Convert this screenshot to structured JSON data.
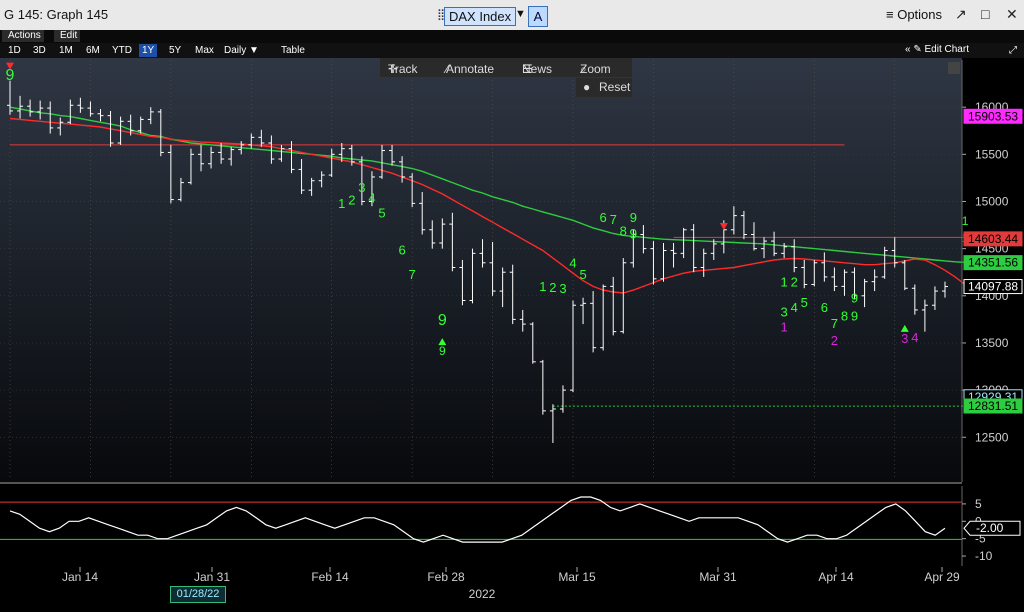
{
  "window": {
    "title": "G 145: Graph 145",
    "ticker": "DAX Index",
    "ticker_button": "A",
    "options": "Options"
  },
  "menu": {
    "actions": "Actions",
    "edit": "Edit"
  },
  "ranges": [
    "1D",
    "3D",
    "1M",
    "6M",
    "YTD",
    "1Y",
    "5Y",
    "Max"
  ],
  "active_range": "1Y",
  "period": "Daily",
  "table_label": "Table",
  "edit_chart": "Edit Chart",
  "floating": {
    "track": "Track",
    "annotate": "Annotate",
    "news": "News",
    "zoom": "Zoom",
    "reset": "Reset"
  },
  "colors": {
    "price": "#ffffff",
    "ma_fast": "#ff2a2a",
    "ma_slow": "#2ecc40",
    "td_count": "#33ff33",
    "td_count_alt": "#dd22dd",
    "osc": "#ffffff"
  },
  "chart_data": {
    "type": "bar",
    "ylim": [
      12100,
      16500
    ],
    "y_ticks": [
      12500,
      13000,
      13500,
      14000,
      14500,
      15000,
      15500,
      16000
    ],
    "x_ticks": [
      "Jan 14",
      "Jan 31",
      "Feb 14",
      "Feb 28",
      "Mar 15",
      "Mar 31",
      "Apr 14",
      "Apr 29"
    ],
    "x_year": "2022",
    "cursor_date": "01/28/22",
    "price_labels": [
      {
        "value": "15903.53",
        "color": "#ff2aff"
      },
      {
        "value": "14603.44",
        "color": "#e23b3b"
      },
      {
        "value": "14351.56",
        "color": "#2ecc40"
      },
      {
        "value": "14097.88",
        "color": "#ffffff"
      },
      {
        "value": "12929.31",
        "color": "#9fe6ff"
      },
      {
        "value": "12831.51",
        "color": "#2ecc40"
      }
    ],
    "ohlc": [
      [
        16020,
        16280,
        15920,
        15960
      ],
      [
        15960,
        16120,
        15880,
        16010
      ],
      [
        16010,
        16080,
        15900,
        15950
      ],
      [
        15950,
        16070,
        15870,
        15990
      ],
      [
        15990,
        16060,
        15720,
        15780
      ],
      [
        15780,
        15890,
        15700,
        15840
      ],
      [
        15840,
        16080,
        15820,
        16020
      ],
      [
        16020,
        16100,
        15940,
        15990
      ],
      [
        15990,
        16060,
        15900,
        15930
      ],
      [
        15930,
        15980,
        15850,
        15910
      ],
      [
        15910,
        15960,
        15580,
        15620
      ],
      [
        15620,
        15900,
        15600,
        15850
      ],
      [
        15850,
        15920,
        15700,
        15750
      ],
      [
        15750,
        15900,
        15720,
        15870
      ],
      [
        15870,
        16000,
        15820,
        15950
      ],
      [
        15950,
        15980,
        15480,
        15520
      ],
      [
        15520,
        15600,
        14980,
        15020
      ],
      [
        15020,
        15250,
        15000,
        15200
      ],
      [
        15200,
        15560,
        15180,
        15500
      ],
      [
        15500,
        15600,
        15320,
        15400
      ],
      [
        15400,
        15580,
        15350,
        15520
      ],
      [
        15520,
        15620,
        15400,
        15450
      ],
      [
        15450,
        15580,
        15380,
        15550
      ],
      [
        15550,
        15640,
        15500,
        15600
      ],
      [
        15600,
        15720,
        15560,
        15680
      ],
      [
        15680,
        15760,
        15580,
        15620
      ],
      [
        15620,
        15700,
        15400,
        15450
      ],
      [
        15450,
        15600,
        15420,
        15560
      ],
      [
        15560,
        15640,
        15300,
        15340
      ],
      [
        15340,
        15450,
        15080,
        15120
      ],
      [
        15120,
        15250,
        15060,
        15220
      ],
      [
        15220,
        15320,
        15150,
        15280
      ],
      [
        15280,
        15560,
        15260,
        15500
      ],
      [
        15500,
        15620,
        15420,
        15560
      ],
      [
        15560,
        15600,
        15380,
        15420
      ],
      [
        15420,
        15480,
        14960,
        15000
      ],
      [
        15000,
        15320,
        14950,
        15260
      ],
      [
        15260,
        15600,
        15240,
        15540
      ],
      [
        15540,
        15600,
        15380,
        15420
      ],
      [
        15420,
        15480,
        15200,
        15260
      ],
      [
        15260,
        15300,
        14940,
        14980
      ],
      [
        14980,
        15100,
        14650,
        14700
      ],
      [
        14700,
        14800,
        14500,
        14560
      ],
      [
        14560,
        14820,
        14500,
        14760
      ],
      [
        14760,
        14880,
        14260,
        14300
      ],
      [
        14300,
        14380,
        13900,
        13950
      ],
      [
        13950,
        14500,
        13920,
        14450
      ],
      [
        14450,
        14600,
        14300,
        14350
      ],
      [
        14350,
        14570,
        14000,
        14050
      ],
      [
        14050,
        14300,
        13880,
        14250
      ],
      [
        14250,
        14330,
        13700,
        13750
      ],
      [
        13750,
        13850,
        13620,
        13700
      ],
      [
        13700,
        13720,
        13280,
        13300
      ],
      [
        13300,
        13320,
        12740,
        12780
      ],
      [
        12780,
        12850,
        12440,
        12800
      ],
      [
        12800,
        13050,
        12760,
        13000
      ],
      [
        13000,
        13950,
        12980,
        13900
      ],
      [
        13900,
        13980,
        13700,
        13920
      ],
      [
        13920,
        14050,
        13400,
        13450
      ],
      [
        13450,
        14120,
        13420,
        14100
      ],
      [
        14100,
        14200,
        13580,
        13620
      ],
      [
        13620,
        14400,
        13600,
        14350
      ],
      [
        14350,
        14700,
        14300,
        14650
      ],
      [
        14650,
        14750,
        14450,
        14500
      ],
      [
        14500,
        14580,
        14120,
        14180
      ],
      [
        14180,
        14560,
        14150,
        14480
      ],
      [
        14480,
        14560,
        14300,
        14450
      ],
      [
        14450,
        14720,
        14400,
        14700
      ],
      [
        14700,
        14760,
        14250,
        14300
      ],
      [
        14300,
        14500,
        14200,
        14450
      ],
      [
        14450,
        14600,
        14380,
        14550
      ],
      [
        14550,
        14800,
        14450,
        14700
      ],
      [
        14700,
        14950,
        14650,
        14850
      ],
      [
        14850,
        14900,
        14600,
        14650
      ],
      [
        14650,
        14780,
        14480,
        14500
      ],
      [
        14500,
        14620,
        14400,
        14580
      ],
      [
        14580,
        14680,
        14420,
        14450
      ],
      [
        14450,
        14560,
        14400,
        14520
      ],
      [
        14520,
        14600,
        14250,
        14300
      ],
      [
        14300,
        14380,
        14080,
        14120
      ],
      [
        14120,
        14380,
        14100,
        14350
      ],
      [
        14350,
        14460,
        14150,
        14200
      ],
      [
        14200,
        14300,
        14050,
        14100
      ],
      [
        14100,
        14280,
        14000,
        14250
      ],
      [
        14250,
        14300,
        13960,
        14000
      ],
      [
        14000,
        14180,
        13880,
        14150
      ],
      [
        14150,
        14280,
        14050,
        14200
      ],
      [
        14200,
        14520,
        14180,
        14480
      ],
      [
        14480,
        14620,
        14300,
        14350
      ],
      [
        14350,
        14380,
        14060,
        14080
      ],
      [
        14080,
        14120,
        13800,
        13850
      ],
      [
        13850,
        13960,
        13620,
        13900
      ],
      [
        13900,
        14100,
        13850,
        14050
      ],
      [
        14050,
        14150,
        13980,
        14097.88
      ]
    ],
    "ma_slow": [
      16000,
      15980,
      15960,
      15940,
      15930,
      15910,
      15900,
      15880,
      15860,
      15840,
      15820,
      15800,
      15760,
      15730,
      15700,
      15690,
      15660,
      15640,
      15620,
      15610,
      15600,
      15590,
      15580,
      15570,
      15560,
      15550,
      15540,
      15530,
      15520,
      15510,
      15500,
      15490,
      15480,
      15460,
      15450,
      15440,
      15430,
      15410,
      15390,
      15370,
      15350,
      15320,
      15280,
      15240,
      15200,
      15160,
      15120,
      15090,
      15050,
      15020,
      14990,
      14950,
      14920,
      14890,
      14860,
      14830,
      14800,
      14760,
      14720,
      14690,
      14660,
      14640,
      14630,
      14620,
      14610,
      14600,
      14595,
      14590,
      14585,
      14580,
      14575,
      14570,
      14565,
      14560,
      14555,
      14550,
      14540,
      14530,
      14520,
      14510,
      14500,
      14490,
      14480,
      14470,
      14460,
      14450,
      14440,
      14430,
      14420,
      14410,
      14400,
      14390,
      14380,
      14370,
      14360,
      14355
    ],
    "ma_fast": [
      15880,
      15870,
      15860,
      15850,
      15840,
      15830,
      15820,
      15810,
      15800,
      15790,
      15770,
      15750,
      15730,
      15710,
      15690,
      15680,
      15660,
      15650,
      15640,
      15630,
      15625,
      15620,
      15615,
      15610,
      15600,
      15590,
      15580,
      15560,
      15540,
      15520,
      15500,
      15480,
      15460,
      15440,
      15420,
      15390,
      15360,
      15330,
      15300,
      15260,
      15220,
      15180,
      15130,
      15080,
      15020,
      14960,
      14900,
      14840,
      14780,
      14720,
      14660,
      14600,
      14540,
      14480,
      14400,
      14320,
      14240,
      14160,
      14100,
      14060,
      14040,
      14030,
      14060,
      14100,
      14140,
      14180,
      14210,
      14240,
      14260,
      14270,
      14280,
      14290,
      14300,
      14320,
      14340,
      14360,
      14380,
      14390,
      14395,
      14390,
      14380,
      14370,
      14360,
      14350,
      14340,
      14330,
      14330,
      14340,
      14350,
      14370,
      14390,
      14380,
      14330,
      14270,
      14200,
      14120
    ],
    "hlines": [
      {
        "value": 15600,
        "color": "#e23b3b",
        "x0": 0,
        "x1": 83
      },
      {
        "value": 14620,
        "color": "#e23b3b",
        "x0": 66,
        "x1": 96
      },
      {
        "value": 12830,
        "color": "#2ecc40",
        "x0": 54,
        "x1": 96,
        "dashed": true
      }
    ],
    "td_labels": [
      {
        "i": 0,
        "t": "9",
        "v": 16290,
        "c": "g",
        "s": 16
      },
      {
        "i": 33,
        "t": "1",
        "v": 14930,
        "c": "g",
        "s": 13
      },
      {
        "i": 34,
        "t": "2",
        "v": 14970,
        "c": "g",
        "s": 13
      },
      {
        "i": 35,
        "t": "3",
        "v": 15100,
        "c": "g",
        "s": 13
      },
      {
        "i": 36,
        "t": "4",
        "v": 14990,
        "c": "g",
        "s": 13
      },
      {
        "i": 37,
        "t": "5",
        "v": 14830,
        "c": "g",
        "s": 13
      },
      {
        "i": 39,
        "t": "6",
        "v": 14440,
        "c": "g",
        "s": 13
      },
      {
        "i": 40,
        "t": "7",
        "v": 14180,
        "c": "g",
        "s": 13
      },
      {
        "i": 43,
        "t": "9",
        "v": 13690,
        "c": "g",
        "s": 16
      },
      {
        "i": 43,
        "t": "9",
        "v": 13370,
        "c": "g",
        "s": 12
      },
      {
        "i": 53,
        "t": "1",
        "v": 14050,
        "c": "g",
        "s": 13
      },
      {
        "i": 54,
        "t": "2",
        "v": 14040,
        "c": "g",
        "s": 13
      },
      {
        "i": 55,
        "t": "3",
        "v": 14030,
        "c": "g",
        "s": 13
      },
      {
        "i": 56,
        "t": "4",
        "v": 14300,
        "c": "g",
        "s": 13
      },
      {
        "i": 57,
        "t": "5",
        "v": 14180,
        "c": "g",
        "s": 13
      },
      {
        "i": 59,
        "t": "6",
        "v": 14780,
        "c": "g",
        "s": 13
      },
      {
        "i": 60,
        "t": "7",
        "v": 14760,
        "c": "g",
        "s": 13
      },
      {
        "i": 61,
        "t": "8",
        "v": 14640,
        "c": "g",
        "s": 13
      },
      {
        "i": 62,
        "t": "9",
        "v": 14610,
        "c": "g",
        "s": 14
      },
      {
        "i": 62,
        "t": "9",
        "v": 14780,
        "c": "g",
        "s": 13
      },
      {
        "i": 77,
        "t": "1",
        "v": 14100,
        "c": "g",
        "s": 13
      },
      {
        "i": 78,
        "t": "2",
        "v": 14100,
        "c": "g",
        "s": 13
      },
      {
        "i": 77,
        "t": "3",
        "v": 13780,
        "c": "g",
        "s": 13
      },
      {
        "i": 78,
        "t": "4",
        "v": 13830,
        "c": "g",
        "s": 13
      },
      {
        "i": 79,
        "t": "5",
        "v": 13880,
        "c": "g",
        "s": 13
      },
      {
        "i": 81,
        "t": "6",
        "v": 13830,
        "c": "g",
        "s": 13
      },
      {
        "i": 82,
        "t": "7",
        "v": 13660,
        "c": "g",
        "s": 13
      },
      {
        "i": 83,
        "t": "8",
        "v": 13740,
        "c": "g",
        "s": 13
      },
      {
        "i": 84,
        "t": "9",
        "v": 13740,
        "c": "g",
        "s": 13
      },
      {
        "i": 84,
        "t": "9",
        "v": 13930,
        "c": "g",
        "s": 13
      },
      {
        "i": 77,
        "t": "1",
        "v": 13620,
        "c": "m",
        "s": 13
      },
      {
        "i": 82,
        "t": "2",
        "v": 13480,
        "c": "m",
        "s": 13
      },
      {
        "i": 89,
        "t": "3",
        "v": 13500,
        "c": "m",
        "s": 13
      },
      {
        "i": 90,
        "t": "4",
        "v": 13510,
        "c": "m",
        "s": 13
      },
      {
        "i": 95,
        "t": "1",
        "v": 14750,
        "c": "g",
        "s": 12
      },
      {
        "i": 95,
        "t": "1",
        "v": 14570,
        "c": "m",
        "s": 12
      }
    ],
    "oscillator": {
      "ylim": [
        -12,
        9
      ],
      "ticks": [
        5,
        0,
        -5,
        -10
      ],
      "upper": 5.5,
      "lower": -5.2,
      "current": "-2.00",
      "values": [
        3,
        2,
        0,
        -2,
        -3,
        -2,
        0,
        0,
        1,
        0,
        -1,
        -2,
        -3,
        -4,
        -4,
        -5,
        -5,
        -4,
        -3,
        -2,
        -1,
        1,
        3,
        4,
        3,
        1,
        -1,
        -2,
        -1,
        0,
        1,
        0,
        -1,
        -2,
        -1,
        0,
        1,
        1,
        0,
        -1,
        -3,
        -5,
        -6,
        -5,
        -4,
        -5,
        -6,
        -6,
        -6,
        -6,
        -6,
        -5,
        -4,
        -2,
        0,
        2,
        4,
        6,
        7,
        7,
        6,
        4,
        3,
        4,
        5,
        4,
        3,
        2,
        1,
        0,
        1,
        1,
        1,
        1,
        1,
        0,
        -1,
        -3,
        -5,
        -6,
        -5,
        -4,
        -4,
        -5,
        -5,
        -4,
        -2,
        0,
        2,
        4,
        5,
        3,
        0,
        -3,
        -4,
        -2
      ]
    }
  }
}
